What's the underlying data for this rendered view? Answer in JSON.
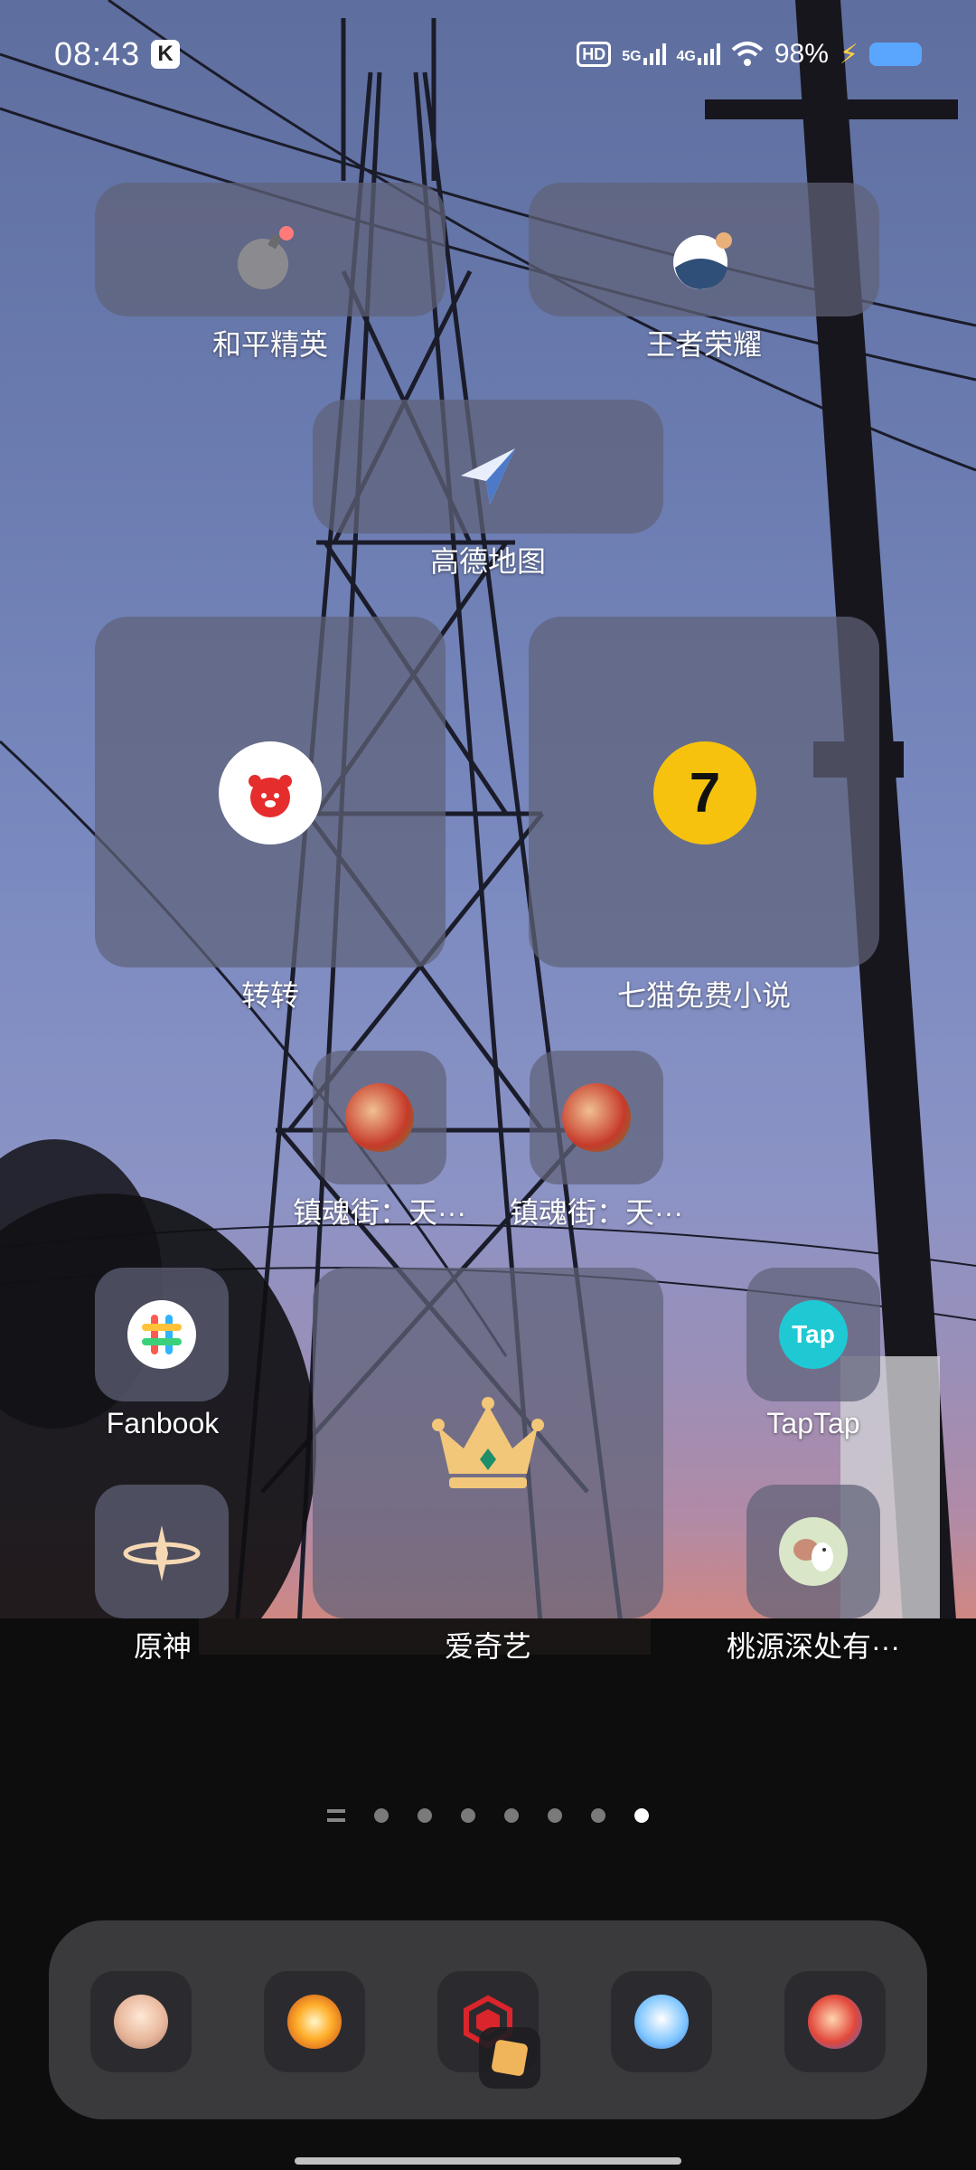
{
  "status_bar": {
    "time": "08:43",
    "k_badge": "K",
    "hd_badge": "HD",
    "net_1": "5G",
    "net_2": "4G",
    "battery_percent": "98%",
    "battery_color": "#5aa6ff"
  },
  "apps": {
    "heping": "和平精英",
    "wangzhe": "王者荣耀",
    "gaode": "高德地图",
    "zhuanzhuan": "转转",
    "qimao": "七猫免费小说",
    "qimao_icon_text": "7",
    "zhenhun_1": "镇魂街：天···",
    "zhenhun_2": "镇魂街：天···",
    "fanbook": "Fanbook",
    "taptap": "TapTap",
    "taptap_icon_text": "Tap",
    "yuanshen": "原神",
    "iqiyi": "爱奇艺",
    "taoyuan": "桃源深处有···"
  },
  "pager": {
    "page_count": 7,
    "current_page": 7
  },
  "dock": {
    "apps": [
      "anime-girl-game-icon",
      "fire-game-icon",
      "red-hexagon-game-icon",
      "cute-bird-game-icon",
      "hero-game-icon"
    ]
  }
}
